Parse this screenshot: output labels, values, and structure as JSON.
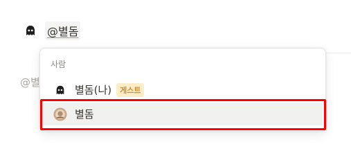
{
  "editor": {
    "mention_text": "@별돔",
    "avatar_icon": "ghost-avatar-icon",
    "background_text": "@별"
  },
  "people_menu": {
    "section_label": "사람",
    "options": [
      {
        "label": "별돔(나)",
        "badge": "게스트",
        "avatar_icon": "ghost-avatar-icon"
      },
      {
        "label": "별돔",
        "avatar_icon": "photo-avatar-icon"
      }
    ]
  },
  "colors": {
    "guest_badge_bg": "#fdecc8",
    "guest_badge_text": "#cb912f",
    "highlight_border": "#ff0000"
  }
}
